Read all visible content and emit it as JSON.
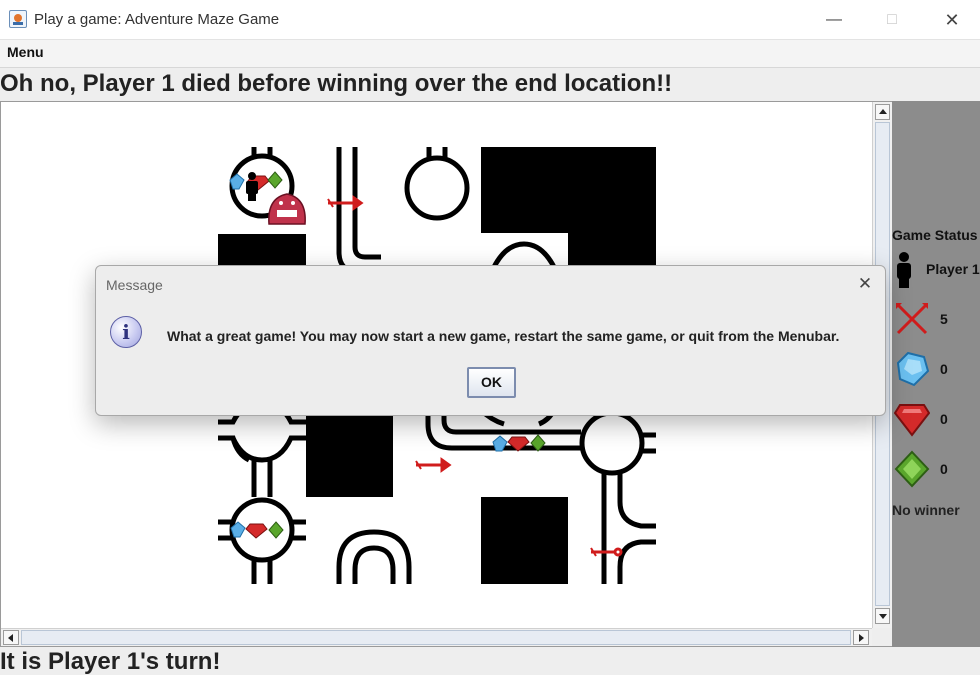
{
  "window": {
    "title": "Play a game: Adventure Maze Game",
    "controls": [
      "minimize-icon",
      "maximize-icon",
      "close-icon"
    ]
  },
  "menubar": {
    "menu_label": "Menu"
  },
  "heading": "Oh no, Player 1 died before winning over the end location!!",
  "maze": {
    "items": [
      "blue-gem-icon",
      "red-gem-icon",
      "green-gem-icon",
      "arrow-icon",
      "monster-icon",
      "player-icon"
    ],
    "colors": {
      "wall": "#000000",
      "floor": "#ffffff",
      "arrow": "#d01c1c",
      "monster": "#c0324b",
      "blue_gem": "#5aaee6",
      "red_gem": "#d42a2a",
      "green_gem": "#5aa62c"
    }
  },
  "status": {
    "title": "Game Status",
    "player": "Player 1",
    "arrows": "5",
    "blue_gems": "0",
    "red_gems": "0",
    "green_gems": "0",
    "winner": "No winner"
  },
  "turn": "It is Player 1's turn!",
  "dialog": {
    "title": "Message",
    "message": "What a great game! You may now start a new game, restart the same game, or quit from the Menubar.",
    "ok_label": "OK",
    "icon": "info-icon"
  }
}
